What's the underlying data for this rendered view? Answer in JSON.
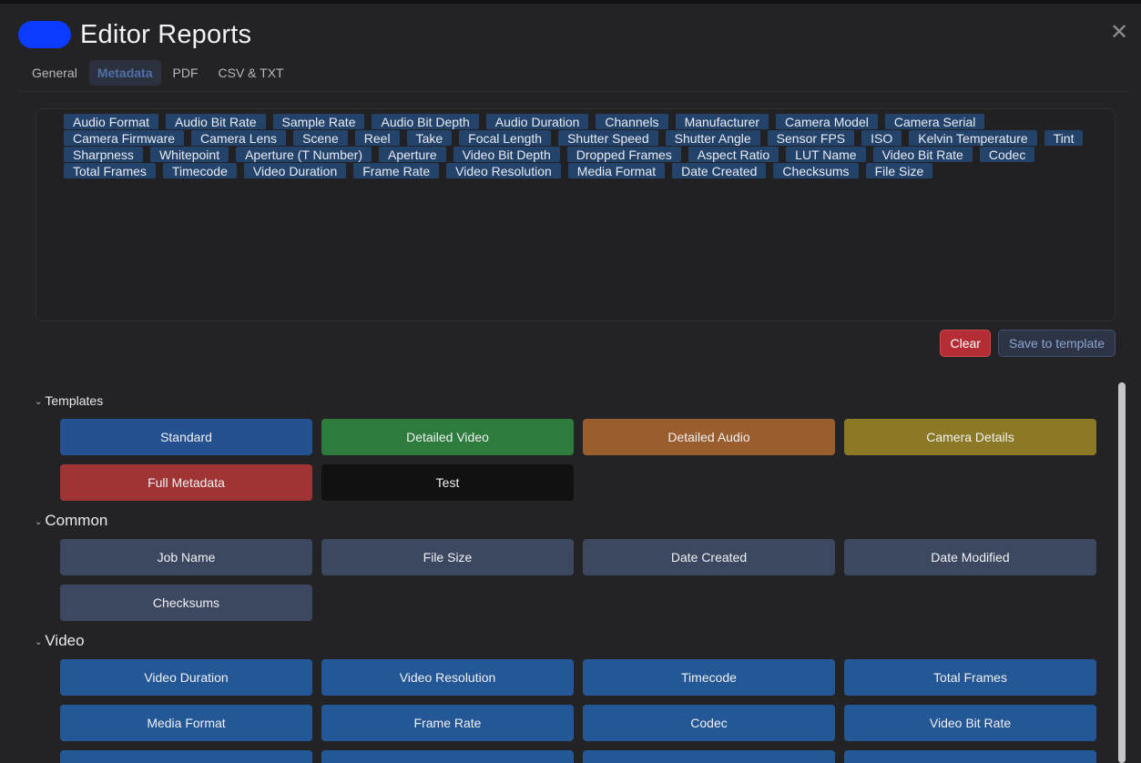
{
  "window": {
    "title": "Editor Reports",
    "close_icon": "close-icon",
    "app_badge_color": "#0a3bff"
  },
  "tabs": [
    {
      "label": "General"
    },
    {
      "label": "Metadata"
    },
    {
      "label": "PDF"
    },
    {
      "label": "CSV & TXT"
    }
  ],
  "selected_fields": [
    "Audio Format",
    "Audio Bit Rate",
    "Sample Rate",
    "Audio Bit Depth",
    "Audio Duration",
    "Channels",
    "Manufacturer",
    "Camera Model",
    "Camera Serial",
    "Camera Firmware",
    "Camera Lens",
    "Scene",
    "Reel",
    "Take",
    "Focal Length",
    "Shutter Speed",
    "Shutter Angle",
    "Sensor FPS",
    "ISO",
    "Kelvin Temperature",
    "Tint",
    "Sharpness",
    "Whitepoint",
    "Aperture (T Number)",
    "Aperture",
    "Video Bit Depth",
    "Dropped Frames",
    "Aspect Ratio",
    "LUT Name",
    "Video Bit Rate",
    "Codec",
    "Total Frames",
    "Timecode",
    "Video Duration",
    "Frame Rate",
    "Video Resolution",
    "Media Format",
    "Date Created",
    "Checksums",
    "File Size"
  ],
  "actions": {
    "clear_label": "Clear",
    "save_label": "Save to template"
  },
  "sections": {
    "templates": {
      "title": "Templates",
      "items": [
        {
          "label": "Standard",
          "color": "#24518f"
        },
        {
          "label": "Detailed Video",
          "color": "#2e7b3e"
        },
        {
          "label": "Detailed Audio",
          "color": "#9a5d2d"
        },
        {
          "label": "Camera Details",
          "color": "#8c7925"
        },
        {
          "label": "Full Metadata",
          "color": "#9f3435"
        },
        {
          "label": "Test",
          "color": "#111112"
        }
      ]
    },
    "common": {
      "title": "Common",
      "items": [
        {
          "label": "Job Name"
        },
        {
          "label": "File Size"
        },
        {
          "label": "Date Created"
        },
        {
          "label": "Date Modified"
        },
        {
          "label": "Checksums"
        }
      ]
    },
    "video": {
      "title": "Video",
      "items": [
        {
          "label": "Video Duration"
        },
        {
          "label": "Video Resolution"
        },
        {
          "label": "Timecode"
        },
        {
          "label": "Total Frames"
        },
        {
          "label": "Media Format"
        },
        {
          "label": "Frame Rate"
        },
        {
          "label": "Codec"
        },
        {
          "label": "Video Bit Rate"
        }
      ]
    }
  }
}
